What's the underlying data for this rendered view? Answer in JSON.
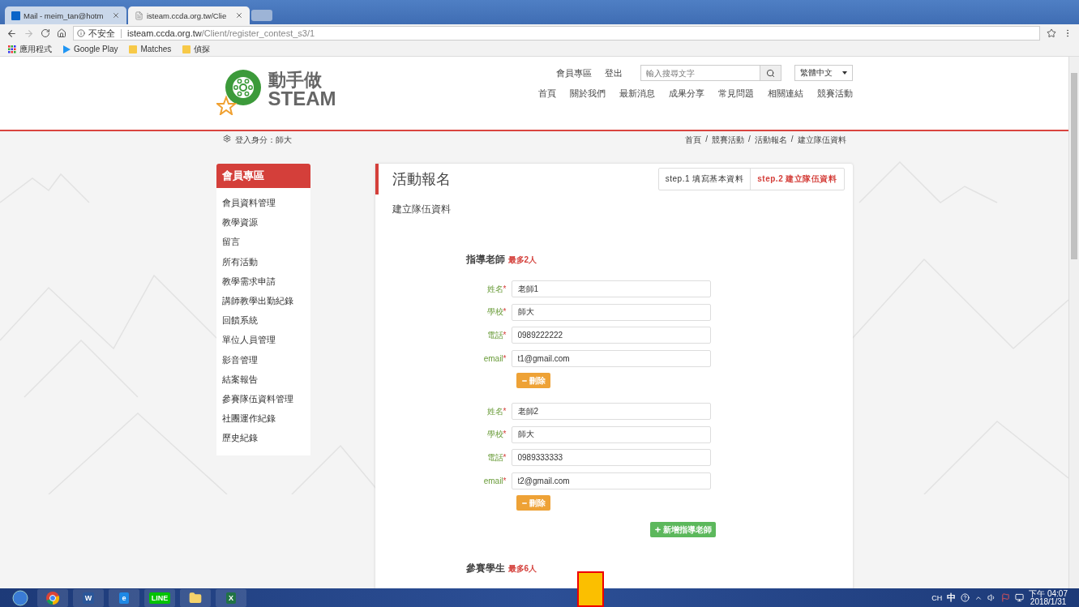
{
  "browser": {
    "tabs": [
      {
        "title": "Mail - meim_tan@hotm",
        "selected": false,
        "kind": "mail"
      },
      {
        "title": "isteam.ccda.org.tw/Clie",
        "selected": true,
        "kind": "page"
      }
    ],
    "security": "不安全",
    "url_host": "isteam.ccda.org.tw",
    "url_path": "/Client/register_contest_s3/1",
    "bookmarks": [
      {
        "label": "應用程式",
        "kind": "apps"
      },
      {
        "label": "Google Play",
        "kind": "play"
      },
      {
        "label": "Matches",
        "kind": "folder"
      },
      {
        "label": "偵探",
        "kind": "folder"
      }
    ]
  },
  "header": {
    "logo_top": "動手做",
    "logo_bottom": "STEAM",
    "top_links": [
      "會員專區",
      "登出"
    ],
    "search": {
      "placeholder": "輸入搜尋文字"
    },
    "language": "繁體中文",
    "nav": [
      "首頁",
      "關於我們",
      "最新消息",
      "成果分享",
      "常見問題",
      "相關連結",
      "競賽活動"
    ]
  },
  "login_status": "登入身分：師大",
  "breadcrumbs": [
    "首頁",
    "競賽活動",
    "活動報名",
    "建立隊伍資料"
  ],
  "breadcrumb_separator": "/",
  "sidebar": {
    "title": "會員專區",
    "items": [
      "會員資料管理",
      "教學資源",
      "留言",
      "所有活動",
      "教學需求申請",
      "講師教學出勤紀錄",
      "回饋系統",
      "單位人員管理",
      "影音管理",
      "結案報告",
      "參賽隊伍資料管理",
      "社團運作紀錄",
      "歷史紀錄"
    ]
  },
  "card": {
    "title": "活動報名",
    "steps": [
      {
        "label": "step.1 填寫基本資料",
        "selected": false
      },
      {
        "label": "step.2 建立隊伍資料",
        "selected": true
      }
    ],
    "subtitle": "建立隊伍資料",
    "teachers": {
      "heading": "指導老師",
      "limit": "最多2人",
      "entries": [
        {
          "fields": [
            {
              "label": "姓名",
              "mark": "*",
              "value": "老師1"
            },
            {
              "label": "學校",
              "mark": "*",
              "value": "師大"
            },
            {
              "label": "電話",
              "mark": "*",
              "value": "0989222222"
            },
            {
              "label": "email",
              "mark": "*",
              "value": "t1@gmail.com"
            }
          ],
          "remove": "刪除"
        },
        {
          "fields": [
            {
              "label": "姓名",
              "mark": "*",
              "value": "老師2"
            },
            {
              "label": "學校",
              "mark": "*",
              "value": "師大"
            },
            {
              "label": "電話",
              "mark": "*",
              "value": "0989333333"
            },
            {
              "label": "email",
              "mark": "*",
              "value": "t2@gmail.com"
            }
          ],
          "remove": "刪除"
        }
      ],
      "add": "新增指導老師"
    },
    "students": {
      "heading": "參賽學生",
      "limit": "最多6人"
    }
  },
  "taskbar": {
    "apps": [
      {
        "kind": "chrome"
      },
      {
        "kind": "word",
        "letter": "W"
      },
      {
        "kind": "ie",
        "letter": "e"
      },
      {
        "kind": "line",
        "letter": "LINE"
      },
      {
        "kind": "folder"
      },
      {
        "kind": "excel",
        "letter": "X"
      }
    ],
    "input_lang": "CH",
    "ime": "中",
    "time": "下午 04:07",
    "date": "2018/1/31"
  }
}
